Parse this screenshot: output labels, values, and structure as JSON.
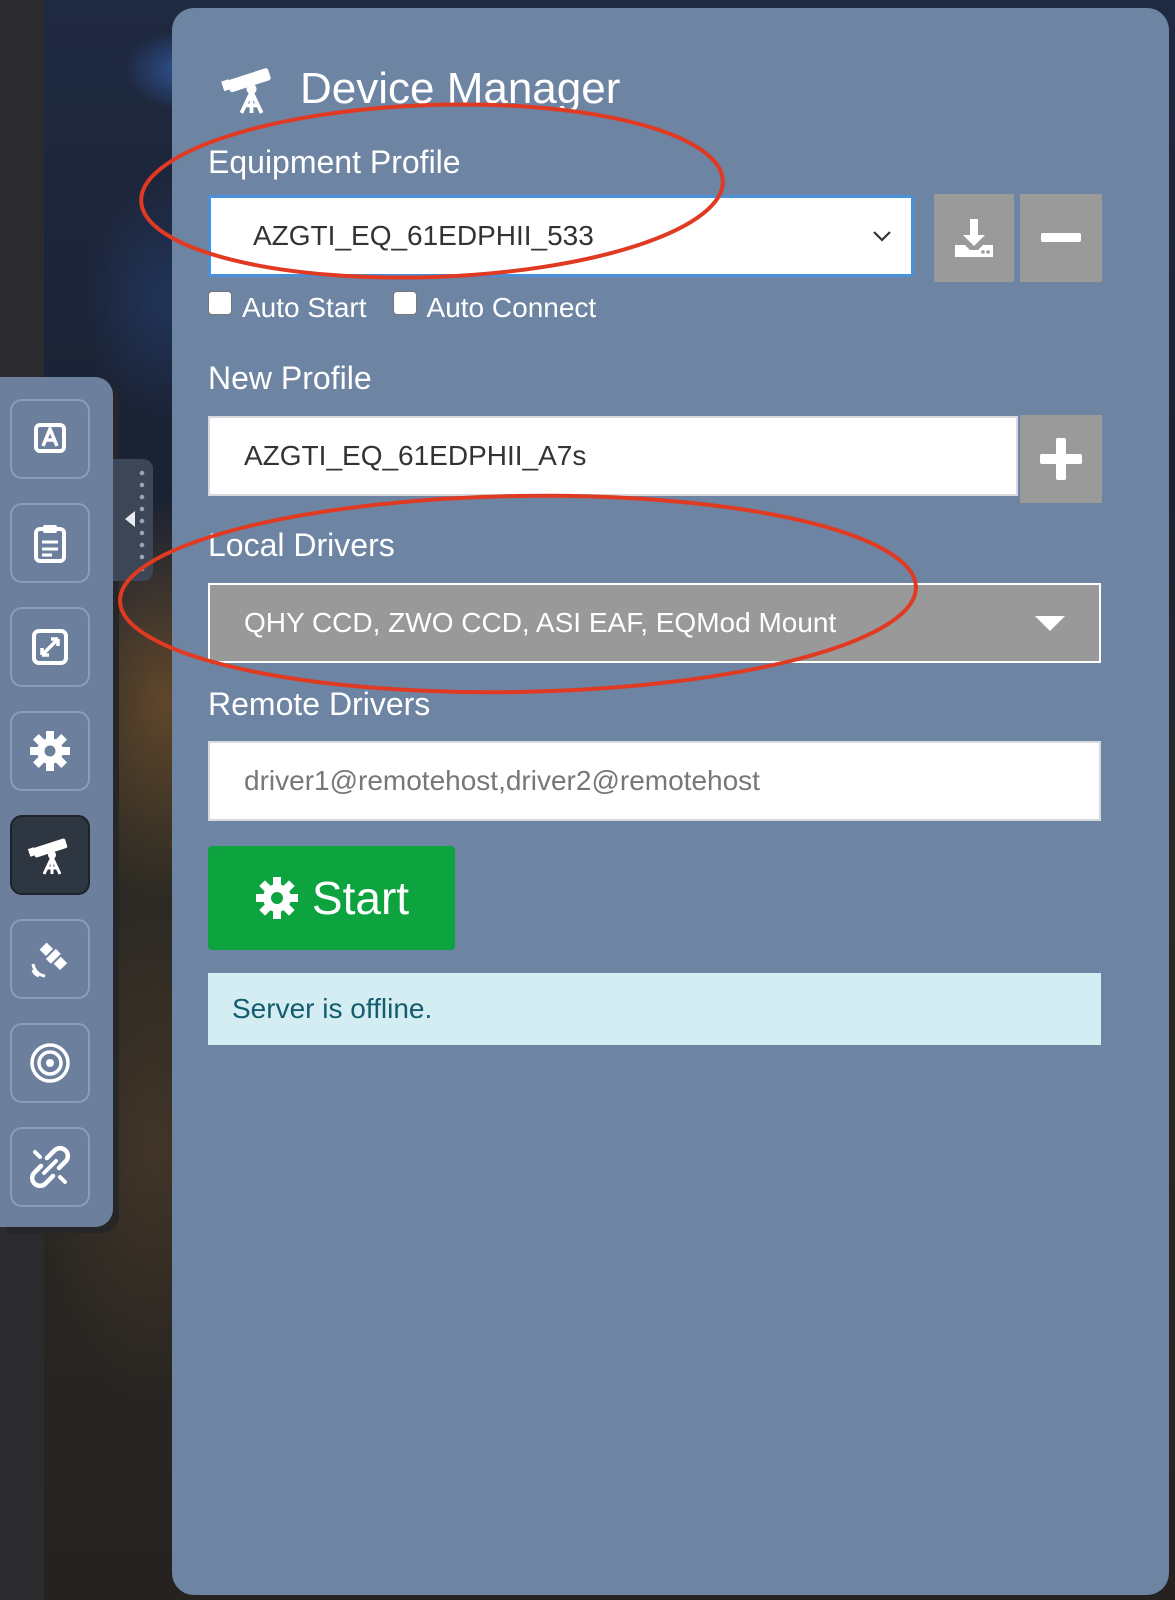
{
  "header": {
    "title": "Device Manager",
    "icon": "telescope-icon"
  },
  "equipment_profile": {
    "label": "Equipment Profile",
    "selected": "AZGTI_EQ_61EDPHII_533",
    "save_icon": "download-icon",
    "remove_icon": "minus-icon",
    "auto_start_label": "Auto Start",
    "auto_connect_label": "Auto Connect",
    "auto_start_checked": false,
    "auto_connect_checked": false
  },
  "new_profile": {
    "label": "New Profile",
    "value": "AZGTI_EQ_61EDPHII_A7s",
    "add_icon": "plus-icon"
  },
  "local_drivers": {
    "label": "Local Drivers",
    "value": "QHY CCD, ZWO CCD, ASI EAF, EQMod Mount"
  },
  "remote_drivers": {
    "label": "Remote Drivers",
    "placeholder": "driver1@remotehost,driver2@remotehost"
  },
  "start_button": {
    "label": "Start",
    "icon": "gear-icon",
    "color": "#0da33e"
  },
  "status": {
    "text": "Server is offline."
  },
  "sidebar": {
    "items": [
      {
        "name": "text-a-icon",
        "active": false
      },
      {
        "name": "clipboard-icon",
        "active": false
      },
      {
        "name": "expand-icon",
        "active": false
      },
      {
        "name": "gear-icon",
        "active": false
      },
      {
        "name": "telescope-icon",
        "active": true
      },
      {
        "name": "satellite-icon",
        "active": false
      },
      {
        "name": "target-icon",
        "active": false
      },
      {
        "name": "unlink-icon",
        "active": false
      }
    ]
  },
  "colors": {
    "panel": "#6e84a3",
    "annotation": "#e03a22",
    "status_bg": "#d3edf3"
  }
}
